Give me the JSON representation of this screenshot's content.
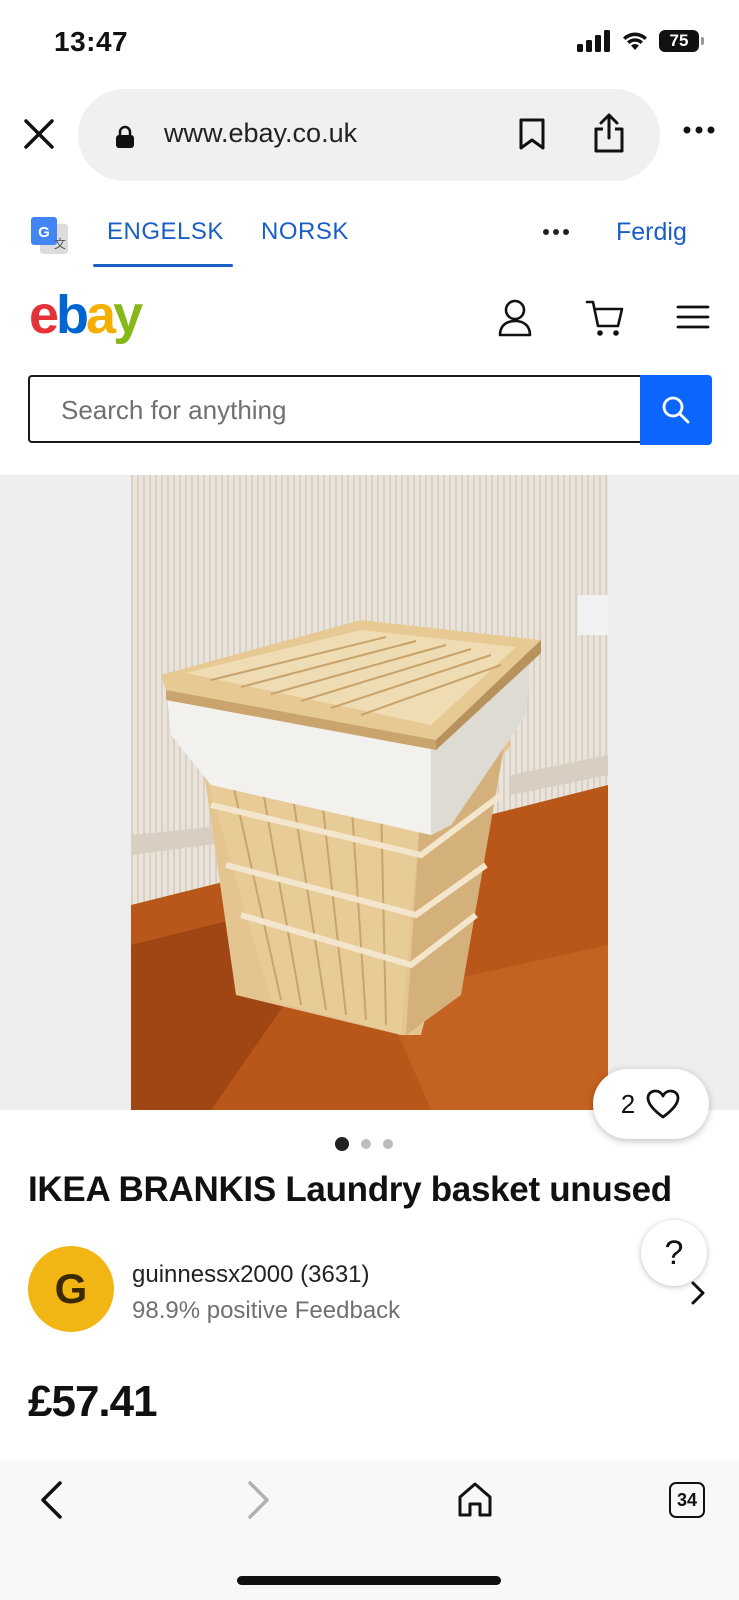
{
  "status_bar": {
    "time": "13:47",
    "battery": "75",
    "icons": [
      "cellular-signal-icon",
      "wifi-icon",
      "battery-icon"
    ]
  },
  "browser": {
    "url": "www.ebay.co.uk",
    "icons": [
      "close-icon",
      "lock-icon",
      "bookmark-icon",
      "share-icon",
      "more-icon"
    ]
  },
  "translate_bar": {
    "tabs": [
      {
        "label": "ENGELSK",
        "active": true
      },
      {
        "label": "NORSK",
        "active": false
      }
    ],
    "done_label": "Ferdig",
    "accent": "#1a5fc8"
  },
  "ebay_header": {
    "logo_letters": [
      "e",
      "b",
      "a",
      "y"
    ],
    "logo_colors": [
      "#e53238",
      "#0064d2",
      "#f5af02",
      "#86b817"
    ],
    "icons": [
      "user-icon",
      "cart-icon",
      "menu-icon"
    ]
  },
  "search": {
    "placeholder": "Search for anything",
    "button_color": "#0b66ff"
  },
  "listing": {
    "watch_count": "2",
    "gallery_total_images": 3,
    "gallery_active_index": 0,
    "title": "IKEA BRANKIS Laundry basket unused",
    "help_label": "?",
    "seller": {
      "initial": "G",
      "name": "guinnessx2000 (3631)",
      "feedback": "98.9% positive Feedback"
    },
    "price": "£57.41"
  },
  "toolbar": {
    "tabs_count": "34",
    "icons": [
      "back-icon",
      "forward-icon",
      "home-icon",
      "tabs-icon"
    ]
  }
}
